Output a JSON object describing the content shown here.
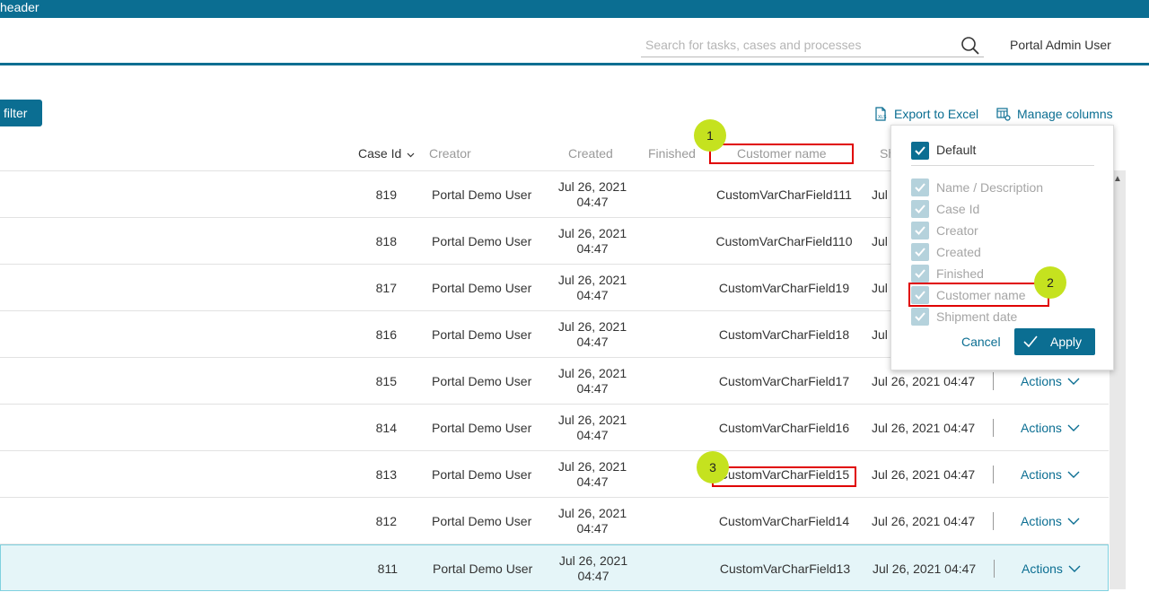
{
  "topbar": {
    "title": "header"
  },
  "header": {
    "search_placeholder": "Search for tasks, cases and processes",
    "user_name": "Portal Admin User"
  },
  "toolbar": {
    "filter_label": "filter",
    "export_label": "Export to Excel",
    "manage_columns_label": "Manage columns"
  },
  "columns": {
    "case_id": "Case Id",
    "creator": "Creator",
    "created": "Created",
    "finished": "Finished",
    "customer_name": "Customer name",
    "shipment_partial": "Sh"
  },
  "rows": [
    {
      "id": "819",
      "creator": "Portal Demo User",
      "created_date": "Jul 26, 2021",
      "created_time": "04:47",
      "customer": "CustomVarCharField111",
      "ship": "Jul",
      "actions": ""
    },
    {
      "id": "818",
      "creator": "Portal Demo User",
      "created_date": "Jul 26, 2021",
      "created_time": "04:47",
      "customer": "CustomVarCharField110",
      "ship": "Jul",
      "actions": ""
    },
    {
      "id": "817",
      "creator": "Portal Demo User",
      "created_date": "Jul 26, 2021",
      "created_time": "04:47",
      "customer": "CustomVarCharField19",
      "ship": "Jul",
      "actions": ""
    },
    {
      "id": "816",
      "creator": "Portal Demo User",
      "created_date": "Jul 26, 2021",
      "created_time": "04:47",
      "customer": "CustomVarCharField18",
      "ship": "Jul",
      "actions": ""
    },
    {
      "id": "815",
      "creator": "Portal Demo User",
      "created_date": "Jul 26, 2021",
      "created_time": "04:47",
      "customer": "CustomVarCharField17",
      "ship": "Jul 26, 2021 04:47",
      "actions": "Actions"
    },
    {
      "id": "814",
      "creator": "Portal Demo User",
      "created_date": "Jul 26, 2021",
      "created_time": "04:47",
      "customer": "CustomVarCharField16",
      "ship": "Jul 26, 2021 04:47",
      "actions": "Actions"
    },
    {
      "id": "813",
      "creator": "Portal Demo User",
      "created_date": "Jul 26, 2021",
      "created_time": "04:47",
      "customer": "CustomVarCharField15",
      "ship": "Jul 26, 2021 04:47",
      "actions": "Actions"
    },
    {
      "id": "812",
      "creator": "Portal Demo User",
      "created_date": "Jul 26, 2021",
      "created_time": "04:47",
      "customer": "CustomVarCharField14",
      "ship": "Jul 26, 2021 04:47",
      "actions": "Actions"
    },
    {
      "id": "811",
      "creator": "Portal Demo User",
      "created_date": "Jul 26, 2021",
      "created_time": "04:47",
      "customer": "CustomVarCharField13",
      "ship": "Jul 26, 2021 04:47",
      "actions": "Actions"
    }
  ],
  "manage_columns_popup": {
    "default_label": "Default",
    "items": [
      "Name / Description",
      "Case Id",
      "Creator",
      "Created",
      "Finished",
      "Customer name",
      "Shipment date"
    ],
    "cancel_label": "Cancel",
    "apply_label": "Apply"
  },
  "badges": {
    "one": "1",
    "two": "2",
    "three": "3"
  },
  "colors": {
    "brand": "#0b6e92",
    "highlight": "#e00000",
    "badge": "#c5e21f"
  }
}
